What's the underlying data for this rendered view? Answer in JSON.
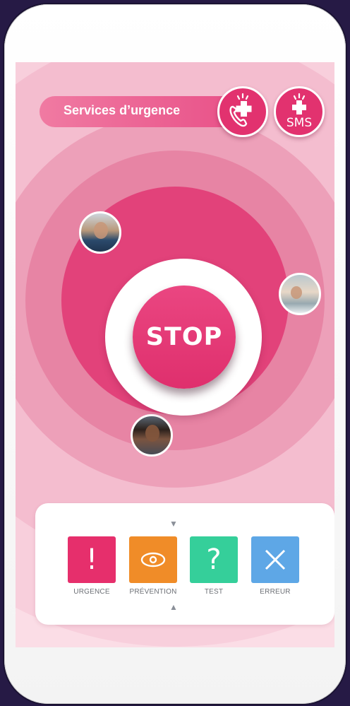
{
  "header": {
    "services_label": "Services d’urgence",
    "call_button_icon": "emergency-call-icon",
    "sms_button_icon": "emergency-sms-icon",
    "sms_text": "SMS"
  },
  "center": {
    "stop_label": "STOP"
  },
  "contacts": [
    {
      "icon": "avatar-older-man"
    },
    {
      "icon": "avatar-woman-seated"
    },
    {
      "icon": "avatar-young-man"
    }
  ],
  "modes": {
    "items": [
      {
        "label": "URGENCE",
        "glyph": "!",
        "color": "#e62f6c"
      },
      {
        "label": "PRÉVENTION",
        "glyph": "◉",
        "color": "#f08c28"
      },
      {
        "label": "TEST",
        "glyph": "?",
        "color": "#35cf9a"
      },
      {
        "label": "ERREUR",
        "glyph": "✕",
        "color": "#5ea7e6"
      }
    ],
    "arrow_down": "▼",
    "arrow_up": "▲"
  },
  "colors": {
    "accent": "#e2326f",
    "background": "#261a45",
    "screen": "#fbdde6"
  }
}
